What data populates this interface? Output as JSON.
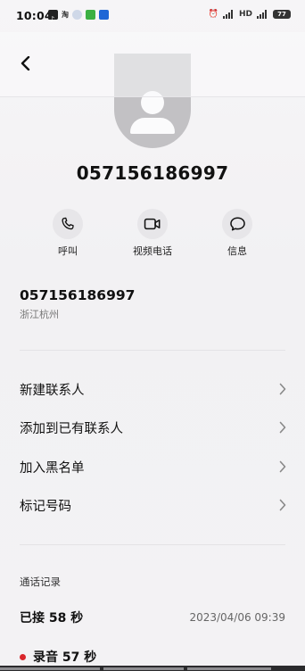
{
  "status_bar": {
    "time": "10:04",
    "notif_text": "淘",
    "network_text": "HD",
    "battery": "77"
  },
  "contact": {
    "number": "057156186997"
  },
  "actions": [
    {
      "label": "呼叫",
      "icon": "phone-icon"
    },
    {
      "label": "视频电话",
      "icon": "video-icon"
    },
    {
      "label": "信息",
      "icon": "message-icon"
    }
  ],
  "info": {
    "number": "057156186997",
    "location": "浙江杭州"
  },
  "menu": [
    {
      "label": "新建联系人"
    },
    {
      "label": "添加到已有联系人"
    },
    {
      "label": "加入黑名单"
    },
    {
      "label": "标记号码"
    }
  ],
  "call_log": {
    "title": "通话记录",
    "status": "已接 58 秒",
    "datetime": "2023/04/06 09:39",
    "recording": "录音 57 秒"
  },
  "colors": {
    "accent_red": "#d9262b",
    "icon_bg": "#e7e6e9"
  }
}
